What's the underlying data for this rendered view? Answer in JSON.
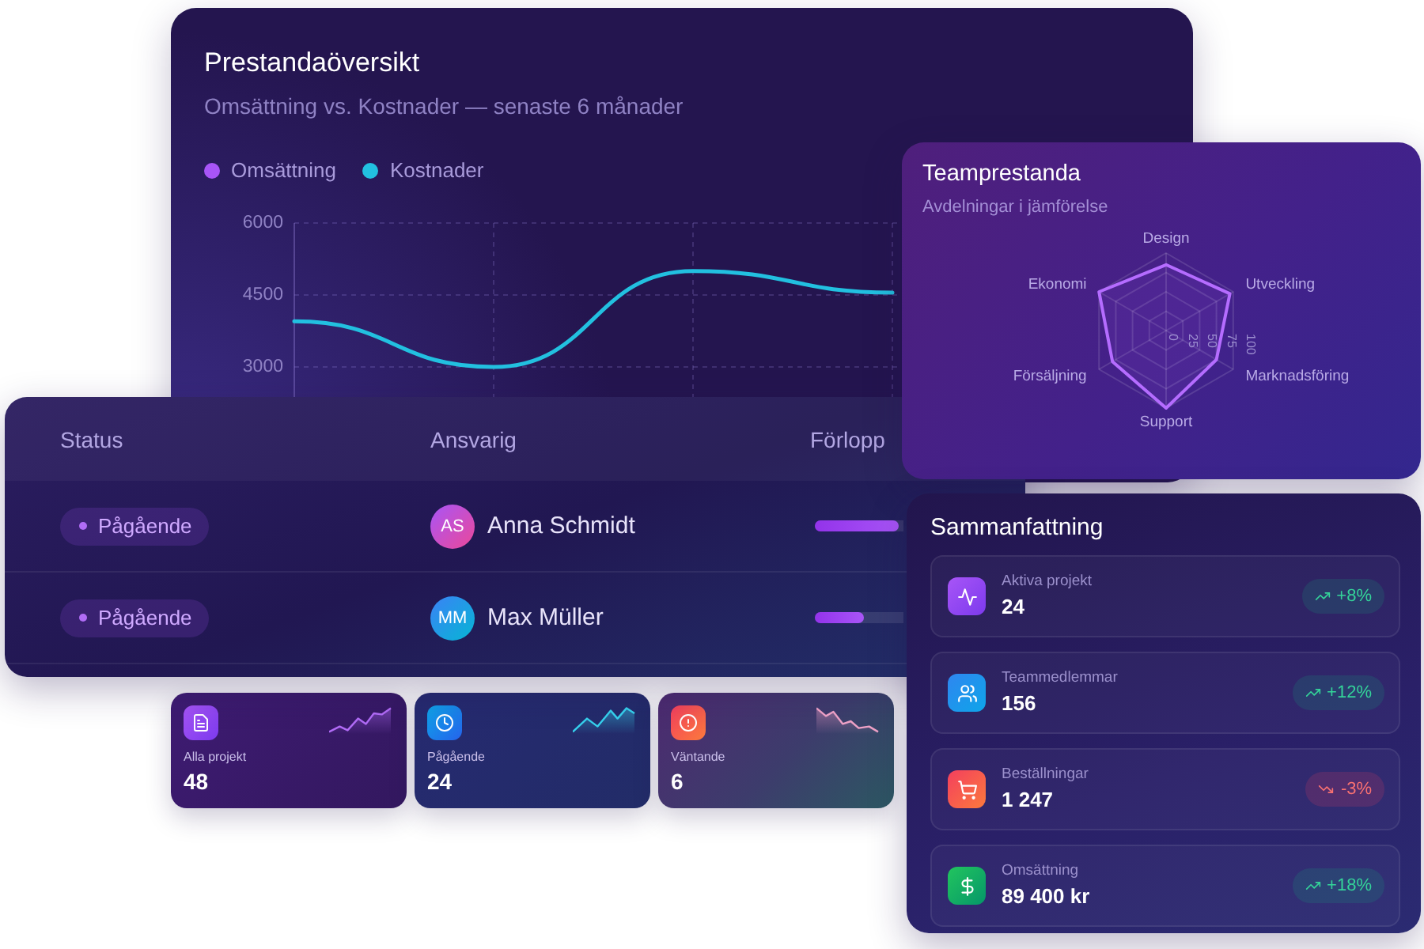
{
  "overview": {
    "title": "Prestandaöversikt",
    "subtitle": "Omsättning vs. Kostnader — senaste 6 månader",
    "chart_data": {
      "type": "line",
      "grid": true,
      "ylim": [
        1500,
        6000
      ],
      "yticks": [
        3000,
        4500,
        6000
      ],
      "series": [
        {
          "name": "Omsättning",
          "color": "#a855f7",
          "values": [
            null,
            null,
            null,
            null
          ]
        },
        {
          "name": "Kostnader",
          "color": "#22c0e0",
          "values": [
            3950,
            3000,
            5000,
            4550
          ]
        }
      ]
    }
  },
  "team": {
    "title": "Teamprestanda",
    "subtitle": "Avdelningar i jämförelse",
    "chart_data": {
      "type": "radar",
      "grid": true,
      "categories": [
        "Design",
        "Utveckling",
        "Marknadsföring",
        "Support",
        "Försäljning",
        "Ekonomi"
      ],
      "values": [
        85,
        95,
        75,
        100,
        80,
        100
      ],
      "ylim": [
        0,
        100
      ],
      "yticks": [
        0,
        25,
        50,
        75,
        100
      ]
    }
  },
  "table": {
    "columns": [
      "Status",
      "Ansvarig",
      "Förlopp"
    ],
    "rows": [
      {
        "status": "Pågående",
        "initials": "AS",
        "name": "Anna Schmidt",
        "level": 0.95
      },
      {
        "status": "Pågående",
        "initials": "MM",
        "name": "Max Müller",
        "level": 0.56
      }
    ]
  },
  "stat_cards": [
    {
      "label": "Alla projekt",
      "value": "48"
    },
    {
      "label": "Pågående",
      "value": "24"
    },
    {
      "label": "Väntande",
      "value": "6"
    }
  ],
  "summary": {
    "title": "Sammanfattning",
    "items": [
      {
        "label": "Aktiva projekt",
        "value": "24",
        "change": "+8%",
        "rising": true
      },
      {
        "label": "Teammedlemmar",
        "value": "156",
        "change": "+12%",
        "rising": true
      },
      {
        "label": "Beställningar",
        "value": "1 247",
        "change": "-3%",
        "rising": false
      },
      {
        "label": "Omsättning",
        "value": "89 400 kr",
        "change": "+18%",
        "rising": true
      }
    ]
  }
}
